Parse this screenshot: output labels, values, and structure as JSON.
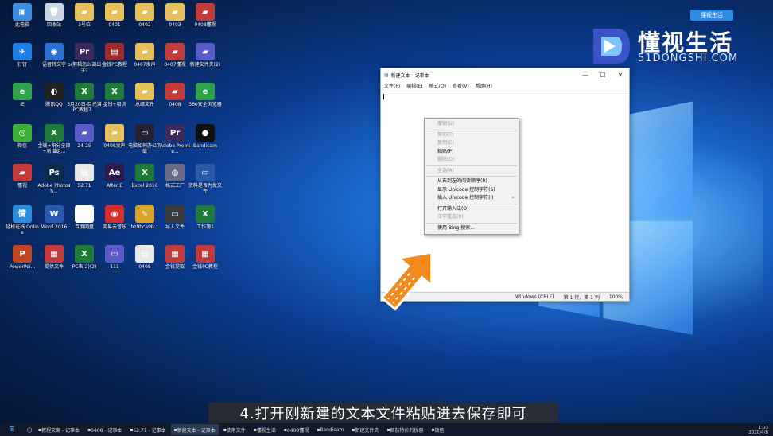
{
  "desktop": {
    "icons": [
      {
        "label": "此电脑",
        "color": "#3a8de0",
        "glyph": "▣"
      },
      {
        "label": "回收站",
        "color": "#c9d6e4",
        "glyph": "🗑"
      },
      {
        "label": "3号位",
        "color": "#e6c15a",
        "glyph": "▰"
      },
      {
        "label": "0401",
        "color": "#e6c15a",
        "glyph": "▰"
      },
      {
        "label": "0402",
        "color": "#e6c15a",
        "glyph": "▰"
      },
      {
        "label": "0403",
        "color": "#e6c15a",
        "glyph": "▰"
      },
      {
        "label": "0408懂视",
        "color": "#c23b3b",
        "glyph": "▰"
      },
      {
        "label": "钉钉",
        "color": "#1d7fe3",
        "glyph": "✈"
      },
      {
        "label": "语音转文字",
        "color": "#2c6fd1",
        "glyph": "◉"
      },
      {
        "label": "pr剪辑怎么调出字?",
        "color": "#3b2a5b",
        "glyph": "Pr"
      },
      {
        "label": "金钱PC教程",
        "color": "#9b2b2b",
        "glyph": "▤"
      },
      {
        "label": "0407发声",
        "color": "#e6c15a",
        "glyph": "▰"
      },
      {
        "label": "0407懂视",
        "color": "#c23b3b",
        "glyph": "▰"
      },
      {
        "label": "新建文件夹(2)",
        "color": "#5a5ac8",
        "glyph": "▰"
      },
      {
        "label": "IE",
        "color": "#2ea34a",
        "glyph": "e"
      },
      {
        "label": "腾讯QQ",
        "color": "#222",
        "glyph": "◐"
      },
      {
        "label": "3月20日-目光谱PC教程7...",
        "color": "#1f7a3a",
        "glyph": "X"
      },
      {
        "label": "金钱+培训",
        "color": "#1f7a3a",
        "glyph": "X"
      },
      {
        "label": "总结文件",
        "color": "#e6c15a",
        "glyph": "▰"
      },
      {
        "label": "0408",
        "color": "#c23b3b",
        "glyph": "▰"
      },
      {
        "label": "360安全浏览器",
        "color": "#2ea34a",
        "glyph": "e"
      },
      {
        "label": "微信",
        "color": "#3cb034",
        "glyph": "◎"
      },
      {
        "label": "金钱+积分全部+新增组...",
        "color": "#1f7a3a",
        "glyph": "X"
      },
      {
        "label": "24-25",
        "color": "#5a5ac8",
        "glyph": "▰"
      },
      {
        "label": "0408发声",
        "color": "#e6c15a",
        "glyph": "▰"
      },
      {
        "label": "电脑如何办公下载",
        "color": "#223",
        "glyph": "▭"
      },
      {
        "label": "Adobe Premie...",
        "color": "#3b2a5b",
        "glyph": "Pr"
      },
      {
        "label": "Bandicam",
        "color": "#111",
        "glyph": "●"
      },
      {
        "label": "懂视",
        "color": "#c23b3b",
        "glyph": "▰"
      },
      {
        "label": "Adobe Photosh...",
        "color": "#0b2b4a",
        "glyph": "Ps"
      },
      {
        "label": "52.71",
        "color": "#e9e9e9",
        "glyph": "▤"
      },
      {
        "label": "After E",
        "color": "#2b1b4a",
        "glyph": "Ae"
      },
      {
        "label": "Excel 2016",
        "color": "#1f7a3a",
        "glyph": "X"
      },
      {
        "label": "格式工厂",
        "color": "#6a6a8a",
        "glyph": "◍"
      },
      {
        "label": "资料是否为发文件",
        "color": "#2a5aa8",
        "glyph": "▭"
      },
      {
        "label": "轻松在线 Online",
        "color": "#2a8fe0",
        "glyph": "情"
      },
      {
        "label": "Word 2016",
        "color": "#2a5ab0",
        "glyph": "W"
      },
      {
        "label": "百度网盘",
        "color": "#fff",
        "glyph": "☁"
      },
      {
        "label": "网易云音乐",
        "color": "#d62d2d",
        "glyph": "◉"
      },
      {
        "label": "bz9bca9b...",
        "color": "#d9a22a",
        "glyph": "✎"
      },
      {
        "label": "导入文件",
        "color": "#3a3a3a",
        "glyph": "▭"
      },
      {
        "label": "工作簿1",
        "color": "#1f7a3a",
        "glyph": "X"
      },
      {
        "label": "PowerPoi...",
        "color": "#c2451f",
        "glyph": "P"
      },
      {
        "label": "提供文件",
        "color": "#c23b3b",
        "glyph": "▦"
      },
      {
        "label": "PC表(2)(2)",
        "color": "#1f7a3a",
        "glyph": "X"
      },
      {
        "label": "111",
        "color": "#5a5ac8",
        "glyph": "▭"
      },
      {
        "label": "0408",
        "color": "#e9e9e9",
        "glyph": "▤"
      },
      {
        "label": "金钱提取",
        "color": "#c23b3b",
        "glyph": "▦"
      },
      {
        "label": "金钱PC教程",
        "color": "#c23b3b",
        "glyph": "▦"
      }
    ]
  },
  "notepad": {
    "title": "新建文本 - 记事本",
    "menu": [
      "文件(F)",
      "编辑(E)",
      "格式(O)",
      "查看(V)",
      "帮助(H)"
    ],
    "status": {
      "encoding_eol": "Windows (CRLF)",
      "position": "第 1 行，第 1 列",
      "zoom": "100%"
    }
  },
  "context_menu": {
    "groups": [
      [
        {
          "label": "撤销(U)",
          "disabled": true
        }
      ],
      [
        {
          "label": "剪切(T)",
          "disabled": true
        },
        {
          "label": "复制(C)",
          "disabled": true
        },
        {
          "label": "粘贴(P)",
          "disabled": false
        },
        {
          "label": "删除(D)",
          "disabled": true
        }
      ],
      [
        {
          "label": "全选(A)",
          "disabled": true
        }
      ],
      [
        {
          "label": "从右到左的阅读顺序(R)",
          "disabled": false
        },
        {
          "label": "显示 Unicode 控制字符(S)",
          "disabled": false
        },
        {
          "label": "插入 Unicode 控制字符(I)",
          "disabled": false,
          "submenu": true
        }
      ],
      [
        {
          "label": "打开输入法(O)",
          "disabled": false
        },
        {
          "label": "汉字重选(R)",
          "disabled": true
        }
      ],
      [
        {
          "label": "使用 Bing 搜索...",
          "disabled": false
        }
      ]
    ]
  },
  "brand": {
    "name": "懂视生活",
    "site": "51DONGSHI.COM",
    "badge": "懂视生活"
  },
  "caption": "4.打开刚新建的文本文件粘贴进去保存即可",
  "taskbar": {
    "items": [
      "教程文案 - 记事本",
      "0408 - 记事本",
      "52.71 - 记事本",
      "新建文本 - 记事本",
      "使用文件",
      "懂视生活",
      "0408懂视",
      "Bandicam",
      "新建文件夹",
      "目前特价的优惠",
      "微信"
    ],
    "active_index": 3,
    "time": "1:03",
    "date": "2020/4/8"
  },
  "colors": {
    "accent": "#2a8ae6",
    "caption_bg": "#2d2d2d",
    "taskbar": "#101a2a"
  }
}
